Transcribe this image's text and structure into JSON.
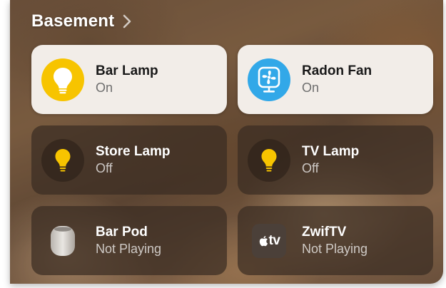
{
  "room": {
    "title": "Basement"
  },
  "accessories": [
    {
      "name": "Bar Lamp",
      "status": "On",
      "icon": "lightbulb-icon"
    },
    {
      "name": "Radon Fan",
      "status": "On",
      "icon": "fan-icon"
    },
    {
      "name": "Store Lamp",
      "status": "Off",
      "icon": "lightbulb-icon"
    },
    {
      "name": "TV Lamp",
      "status": "Off",
      "icon": "lightbulb-icon"
    },
    {
      "name": "Bar Pod",
      "status": "Not Playing",
      "icon": "homepod-icon"
    },
    {
      "name": "ZwifTV",
      "status": "Not Playing",
      "icon": "apple-tv-icon",
      "icon_text": "tv"
    }
  ],
  "colors": {
    "bulb_on_bg": "#f7c400",
    "fan_on_bg": "#32a8e8",
    "tile_on_bg": "#f2ede8",
    "bulb_off": "#f7c400"
  }
}
